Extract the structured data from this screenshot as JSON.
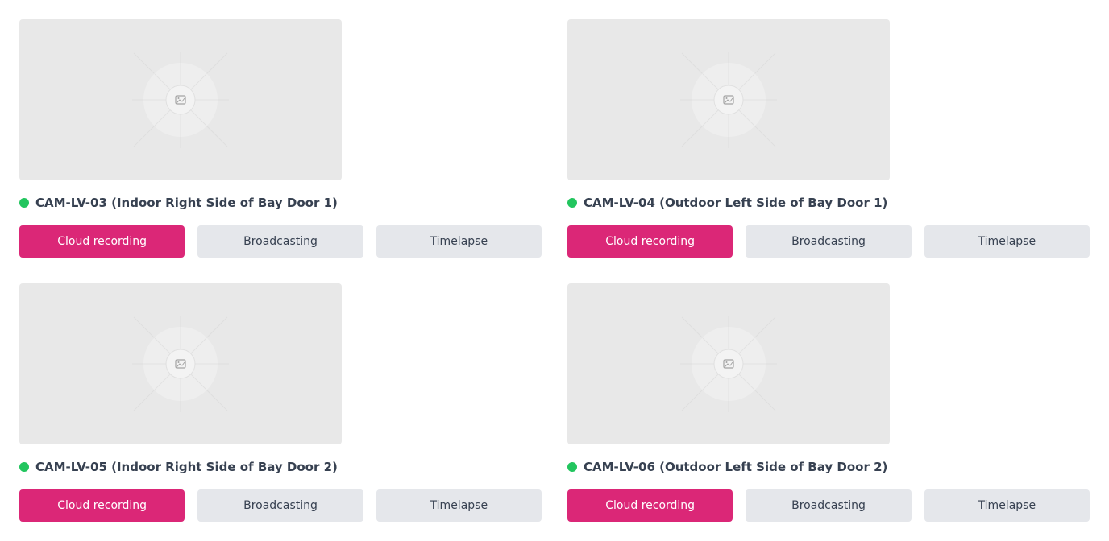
{
  "colors": {
    "accent": "#db2777",
    "online": "#22c55e",
    "thumb_bg": "#e8e8e8",
    "secondary_btn": "#e5e7eb",
    "text": "#374151"
  },
  "cameras": [
    {
      "title": "CAM-LV-03 (Indoor Right Side of Bay Door 1)",
      "status": "online",
      "thumbnail_icon": "image-placeholder-icon",
      "buttons": {
        "cloud": "Cloud recording",
        "broadcast": "Broadcasting",
        "timelapse": "Timelapse"
      }
    },
    {
      "title": "CAM-LV-04 (Outdoor Left Side of Bay Door 1)",
      "status": "online",
      "thumbnail_icon": "image-placeholder-icon",
      "buttons": {
        "cloud": "Cloud recording",
        "broadcast": "Broadcasting",
        "timelapse": "Timelapse"
      }
    },
    {
      "title": "CAM-LV-05 (Indoor Right Side of Bay Door 2)",
      "status": "online",
      "thumbnail_icon": "image-placeholder-icon",
      "buttons": {
        "cloud": "Cloud recording",
        "broadcast": "Broadcasting",
        "timelapse": "Timelapse"
      }
    },
    {
      "title": "CAM-LV-06 (Outdoor Left Side of Bay Door 2)",
      "status": "online",
      "thumbnail_icon": "image-placeholder-icon",
      "buttons": {
        "cloud": "Cloud recording",
        "broadcast": "Broadcasting",
        "timelapse": "Timelapse"
      }
    }
  ]
}
